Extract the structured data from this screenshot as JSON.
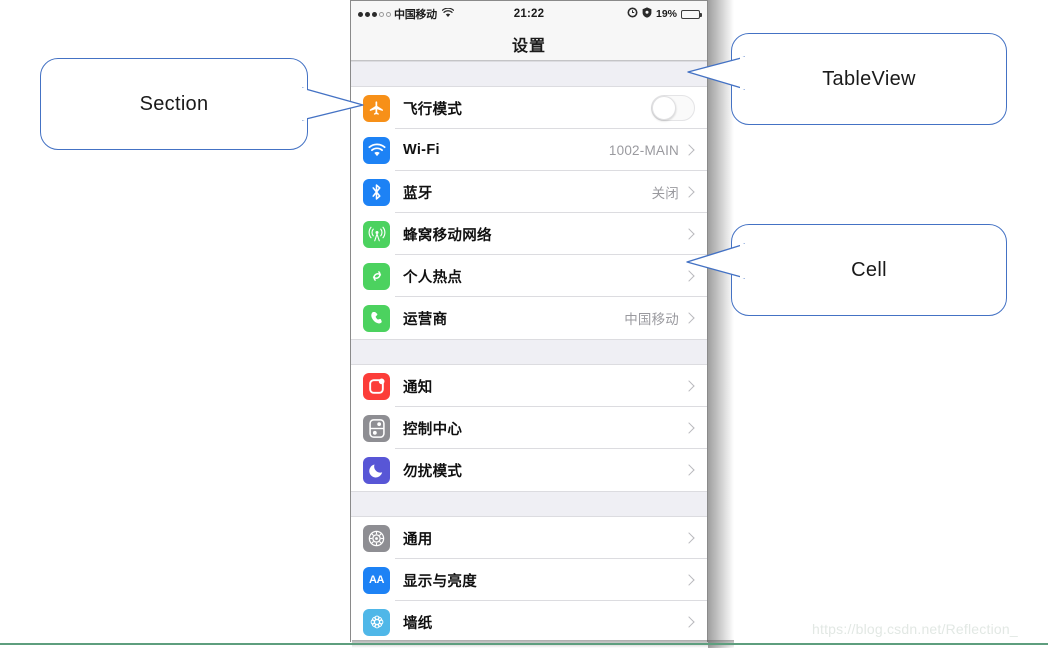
{
  "watermark": "https://blog.csdn.net/Reflection_",
  "phone": {
    "status_bar": {
      "carrier": "中国移动",
      "signal_filled_dots": 3,
      "signal_hollow_dots": 2,
      "wifi_icon": "wifi-icon",
      "time": "21:22",
      "alarm_icon": "alarm-clock-icon",
      "lock_icon": "rotation-lock-icon",
      "battery_percent": "19%",
      "battery_level": 19,
      "battery_color": "#f0322c"
    },
    "nav_bar": {
      "title": "设置"
    },
    "sections": [
      {
        "cells": [
          {
            "icon": "airplane-icon",
            "icon_color": "#f79018",
            "title": "飞行模式",
            "accessory": "switch",
            "switch_on": false
          },
          {
            "icon": "wifi-icon",
            "icon_color": "#1d82f5",
            "title": "Wi-Fi",
            "detail": "1002-MAIN",
            "accessory": "chevron"
          },
          {
            "icon": "bluetooth-icon",
            "icon_color": "#1d82f5",
            "title": "蓝牙",
            "detail": "关闭",
            "accessory": "chevron"
          },
          {
            "icon": "cellular-tower-icon",
            "icon_color": "#4cd25f",
            "title": "蜂窝移动网络",
            "detail": "",
            "accessory": "chevron"
          },
          {
            "icon": "personal-hotspot-icon",
            "icon_color": "#4cd25f",
            "title": "个人热点",
            "detail": "",
            "accessory": "chevron"
          },
          {
            "icon": "phone-handset-icon",
            "icon_color": "#4cd25f",
            "title": "运营商",
            "detail": "中国移动",
            "accessory": "chevron"
          }
        ]
      },
      {
        "cells": [
          {
            "icon": "notification-icon",
            "icon_color": "#fc3d39",
            "title": "通知",
            "detail": "",
            "accessory": "chevron"
          },
          {
            "icon": "control-center-icon",
            "icon_color": "#8e8e93",
            "title": "控制中心",
            "detail": "",
            "accessory": "chevron"
          },
          {
            "icon": "moon-icon",
            "icon_color": "#5856d6",
            "title": "勿扰模式",
            "detail": "",
            "accessory": "chevron"
          }
        ]
      },
      {
        "cells": [
          {
            "icon": "gear-icon",
            "icon_color": "#8e8e93",
            "title": "通用",
            "detail": "",
            "accessory": "chevron"
          },
          {
            "icon": "display-brightness-icon",
            "icon_color": "#1d82f5",
            "title": "显示与亮度",
            "detail": "",
            "accessory": "chevron",
            "icon_text": "AA"
          },
          {
            "icon": "wallpaper-icon",
            "icon_color": "#4fb7e8",
            "title": "墙纸",
            "detail": "",
            "accessory": "chevron"
          }
        ]
      }
    ]
  },
  "callouts": {
    "section": {
      "label": "Section",
      "border_color": "#4472c4"
    },
    "tableview": {
      "label": "TableView",
      "border_color": "#4472c4"
    },
    "cell": {
      "label": "Cell",
      "border_color": "#4472c4"
    }
  }
}
